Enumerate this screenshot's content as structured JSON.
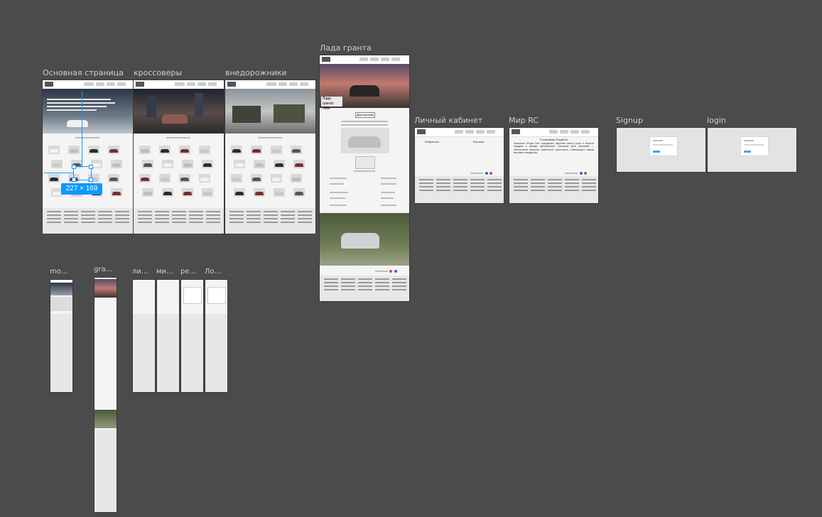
{
  "frames": {
    "main": "Основная страница",
    "crossovers": "кроссоверы",
    "suv": "внедорожники",
    "lada": "Лада гранта",
    "account": "Личный кабинет",
    "mir": "Мир RC",
    "signup": "Signup",
    "login": "login"
  },
  "mobile_frames": [
    "mo...",
    "gra...",
    "ли...",
    "ми...",
    "ре...",
    "Ло..."
  ],
  "selection": {
    "size": "227 × 169"
  },
  "lada_page": {
    "hero_title": "Лада гранта",
    "hero_price": "300к",
    "section": "Достоинства"
  },
  "account_page": {
    "favorites": "Избранное",
    "cart": "Корзина"
  },
  "mir_page": {
    "heading": "О компании RoyalCar",
    "body": "Компания «Royal Car» предлагает широкий спектр услуг в области продажи и аренды автомобилей. Основная цель компании — обеспечение качества клиентского транспорта, отвечающего самым высоким стандартам."
  },
  "colors": {
    "canvas": "#4b4b4b",
    "accent": "#0d99ff"
  }
}
